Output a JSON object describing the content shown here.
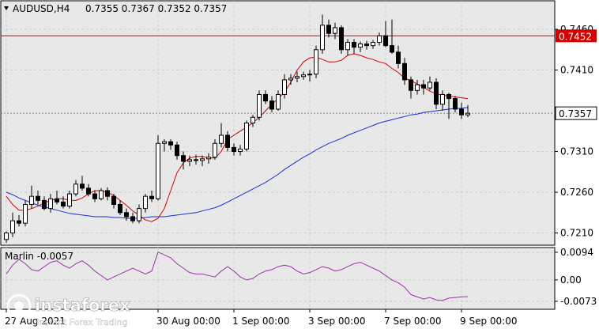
{
  "header": {
    "symbol_tf": "AUDUSD,H4",
    "ohlc": "0.7355 0.7367 0.7352 0.7357"
  },
  "levels": {
    "resistance_label": "0.7452",
    "current_label": "0.7357"
  },
  "oscillator": {
    "label": "Marlin -0.0057"
  },
  "watermark": {
    "brand": "instaforex",
    "tagline": "Instant Forex Trading"
  },
  "colors": {
    "background": "#ffffff",
    "plot_bg": "#e8e8e8",
    "grid": "#cccccc",
    "resistance": "#d40000",
    "fast_ma": "#d40000",
    "slow_ma": "#1e2dd2",
    "oscillator": "#a030b0",
    "candle_up": "#ffffff",
    "candle_down": "#000000"
  },
  "chart_data": [
    {
      "type": "candlestick",
      "title": "AUDUSD,H4",
      "x_tick_labels": [
        "27 Aug 2021",
        "30 Aug 00:00",
        "1 Sep 00:00",
        "3 Sep 00:00",
        "7 Sep 00:00",
        "9 Sep 00:00"
      ],
      "y_tick_labels": [
        "0.7460",
        "0.7410",
        "0.7310",
        "0.7260",
        "0.7210"
      ],
      "ylim": [
        0.7195,
        0.7495
      ],
      "horizontal_lines": [
        {
          "name": "resistance",
          "value": 0.7452
        },
        {
          "name": "current",
          "value": 0.7357
        }
      ],
      "candles": [
        [
          0.7202,
          0.7212,
          0.7198,
          0.721
        ],
        [
          0.721,
          0.7235,
          0.7205,
          0.7225
        ],
        [
          0.7225,
          0.7232,
          0.7218,
          0.7222
        ],
        [
          0.7222,
          0.725,
          0.7218,
          0.7245
        ],
        [
          0.7245,
          0.7268,
          0.724,
          0.7255
        ],
        [
          0.7255,
          0.7262,
          0.7245,
          0.725
        ],
        [
          0.725,
          0.7255,
          0.7238,
          0.724
        ],
        [
          0.724,
          0.7258,
          0.7235,
          0.7252
        ],
        [
          0.7252,
          0.7262,
          0.7245,
          0.7248
        ],
        [
          0.7248,
          0.7255,
          0.724,
          0.7243
        ],
        [
          0.7243,
          0.7262,
          0.724,
          0.7258
        ],
        [
          0.7258,
          0.7275,
          0.7255,
          0.727
        ],
        [
          0.727,
          0.728,
          0.7262,
          0.7265
        ],
        [
          0.7265,
          0.727,
          0.7255,
          0.7258
        ],
        [
          0.7258,
          0.7262,
          0.7248,
          0.7252
        ],
        [
          0.7252,
          0.7265,
          0.725,
          0.7262
        ],
        [
          0.7262,
          0.7266,
          0.725,
          0.7255
        ],
        [
          0.7255,
          0.7258,
          0.724,
          0.7245
        ],
        [
          0.7245,
          0.725,
          0.7232,
          0.7235
        ],
        [
          0.7235,
          0.724,
          0.7225,
          0.723
        ],
        [
          0.723,
          0.7235,
          0.7222,
          0.7225
        ],
        [
          0.7225,
          0.7245,
          0.7222,
          0.724
        ],
        [
          0.724,
          0.7258,
          0.7235,
          0.7255
        ],
        [
          0.7255,
          0.7262,
          0.7248,
          0.7252
        ],
        [
          0.7252,
          0.733,
          0.725,
          0.732
        ],
        [
          0.732,
          0.7325,
          0.731,
          0.7322
        ],
        [
          0.7322,
          0.7325,
          0.7312,
          0.7318
        ],
        [
          0.7318,
          0.7322,
          0.73,
          0.7305
        ],
        [
          0.7305,
          0.731,
          0.7288,
          0.7298
        ],
        [
          0.7298,
          0.7305,
          0.7292,
          0.73
        ],
        [
          0.73,
          0.7306,
          0.7294,
          0.7299
        ],
        [
          0.7299,
          0.7305,
          0.7292,
          0.7301
        ],
        [
          0.7301,
          0.7308,
          0.7295,
          0.7303
        ],
        [
          0.7303,
          0.7325,
          0.73,
          0.732
        ],
        [
          0.732,
          0.7345,
          0.7315,
          0.733
        ],
        [
          0.733,
          0.7335,
          0.731,
          0.7315
        ],
        [
          0.7315,
          0.732,
          0.7305,
          0.731
        ],
        [
          0.731,
          0.7318,
          0.7305,
          0.7313
        ],
        [
          0.7313,
          0.7348,
          0.731,
          0.7345
        ],
        [
          0.7345,
          0.7355,
          0.734,
          0.7352
        ],
        [
          0.7352,
          0.7385,
          0.7348,
          0.738
        ],
        [
          0.738,
          0.7385,
          0.7368,
          0.7372
        ],
        [
          0.7372,
          0.7378,
          0.7358,
          0.7362
        ],
        [
          0.7362,
          0.7385,
          0.736,
          0.738
        ],
        [
          0.738,
          0.7405,
          0.7375,
          0.7398
        ],
        [
          0.7398,
          0.7405,
          0.7392,
          0.74
        ],
        [
          0.74,
          0.7408,
          0.7395,
          0.7402
        ],
        [
          0.7402,
          0.7408,
          0.7398,
          0.7404
        ],
        [
          0.7404,
          0.741,
          0.7396,
          0.7405
        ],
        [
          0.7405,
          0.744,
          0.74,
          0.7435
        ],
        [
          0.7435,
          0.7478,
          0.743,
          0.7465
        ],
        [
          0.7465,
          0.7472,
          0.745,
          0.7455
        ],
        [
          0.7455,
          0.7468,
          0.7448,
          0.7462
        ],
        [
          0.7462,
          0.7465,
          0.743,
          0.7435
        ],
        [
          0.7435,
          0.7448,
          0.7428,
          0.7444
        ],
        [
          0.7444,
          0.7448,
          0.743,
          0.7438
        ],
        [
          0.7438,
          0.7445,
          0.7432,
          0.7442
        ],
        [
          0.7442,
          0.7446,
          0.7435,
          0.744
        ],
        [
          0.744,
          0.7447,
          0.7436,
          0.7444
        ],
        [
          0.7444,
          0.7456,
          0.744,
          0.7452
        ],
        [
          0.7452,
          0.747,
          0.7438,
          0.744
        ],
        [
          0.744,
          0.7472,
          0.743,
          0.7432
        ],
        [
          0.7432,
          0.744,
          0.7412,
          0.7418
        ],
        [
          0.7418,
          0.7425,
          0.7392,
          0.7398
        ],
        [
          0.7398,
          0.7402,
          0.7375,
          0.7385
        ],
        [
          0.7385,
          0.7398,
          0.738,
          0.7392
        ],
        [
          0.7392,
          0.7398,
          0.738,
          0.7388
        ],
        [
          0.7388,
          0.7402,
          0.7385,
          0.7395
        ],
        [
          0.7395,
          0.74,
          0.7362,
          0.7368
        ],
        [
          0.7368,
          0.7385,
          0.736,
          0.738
        ],
        [
          0.738,
          0.7382,
          0.735,
          0.7375
        ],
        [
          0.7375,
          0.7378,
          0.7358,
          0.7362
        ],
        [
          0.7362,
          0.737,
          0.735,
          0.7355
        ],
        [
          0.7355,
          0.7367,
          0.7352,
          0.7357
        ]
      ],
      "series": [
        {
          "values": [
            0.7255,
            0.7245,
            0.7238,
            0.7238,
            0.724,
            0.7243,
            0.7247,
            0.725,
            0.7252,
            0.7252,
            0.725,
            0.725,
            0.7253,
            0.7258,
            0.7262,
            0.7262,
            0.726,
            0.7256,
            0.725,
            0.7244,
            0.7237,
            0.7232,
            0.7226,
            0.7224,
            0.7228,
            0.724,
            0.7262,
            0.7284,
            0.7296,
            0.7302,
            0.7304,
            0.7304,
            0.7302,
            0.7302,
            0.731,
            0.7325,
            0.733,
            0.7335,
            0.734,
            0.7345,
            0.7352,
            0.736,
            0.7368,
            0.7375,
            0.7383,
            0.7395,
            0.741,
            0.742,
            0.7425,
            0.7426,
            0.7423,
            0.742,
            0.742,
            0.7422,
            0.7428,
            0.743,
            0.7428,
            0.7425,
            0.7423,
            0.742,
            0.7418,
            0.7412,
            0.7407,
            0.74,
            0.7397,
            0.7393,
            0.7389,
            0.7384,
            0.7381,
            0.7379,
            0.7378,
            0.7377,
            0.7376,
            0.7375
          ]
        },
        {
          "values": [
            0.726,
            0.7257,
            0.7253,
            0.725,
            0.7247,
            0.7244,
            0.7242,
            0.724,
            0.7238,
            0.7236,
            0.7234,
            0.7233,
            0.7232,
            0.7231,
            0.723,
            0.723,
            0.723,
            0.7229,
            0.7229,
            0.7228,
            0.7228,
            0.7228,
            0.7229,
            0.723,
            0.723,
            0.723,
            0.7231,
            0.7232,
            0.7233,
            0.7234,
            0.7235,
            0.7237,
            0.7239,
            0.7241,
            0.7244,
            0.7248,
            0.7252,
            0.7256,
            0.726,
            0.7264,
            0.7268,
            0.7272,
            0.7277,
            0.7282,
            0.7288,
            0.7293,
            0.7298,
            0.7303,
            0.7307,
            0.7312,
            0.7316,
            0.732,
            0.7323,
            0.7326,
            0.733,
            0.7333,
            0.7336,
            0.7339,
            0.7342,
            0.7345,
            0.7347,
            0.7349,
            0.7351,
            0.7353,
            0.7355,
            0.7356,
            0.7358,
            0.7359,
            0.736,
            0.7361,
            0.7362,
            0.7363,
            0.7363,
            0.7364
          ]
        }
      ]
    },
    {
      "type": "line",
      "title": "Marlin -0.0057",
      "y_tick_labels": [
        "0.0094",
        "0.00",
        "-0.0073"
      ],
      "ylim": [
        -0.01,
        0.011
      ],
      "values": [
        0.002,
        0.005,
        0.007,
        0.0055,
        0.0035,
        0.003,
        0.0045,
        0.006,
        0.0065,
        0.005,
        0.004,
        0.0055,
        0.0065,
        0.005,
        0.003,
        0.0015,
        0.0,
        0.001,
        0.002,
        0.003,
        0.004,
        0.003,
        0.002,
        0.003,
        0.0095,
        0.0085,
        0.0075,
        0.0055,
        0.004,
        0.0025,
        0.002,
        0.002,
        0.0015,
        0.001,
        0.003,
        0.0045,
        0.003,
        0.001,
        0.0,
        0.0005,
        0.002,
        0.003,
        0.0035,
        0.0045,
        0.005,
        0.0045,
        0.003,
        0.002,
        0.0025,
        0.0035,
        0.0045,
        0.004,
        0.003,
        0.0035,
        0.0045,
        0.0055,
        0.006,
        0.005,
        0.004,
        0.003,
        0.0015,
        0.0,
        -0.001,
        -0.0025,
        -0.005,
        -0.0058,
        -0.0065,
        -0.006,
        -0.0068,
        -0.007,
        -0.0062,
        -0.006,
        -0.0058,
        -0.0057
      ]
    }
  ]
}
